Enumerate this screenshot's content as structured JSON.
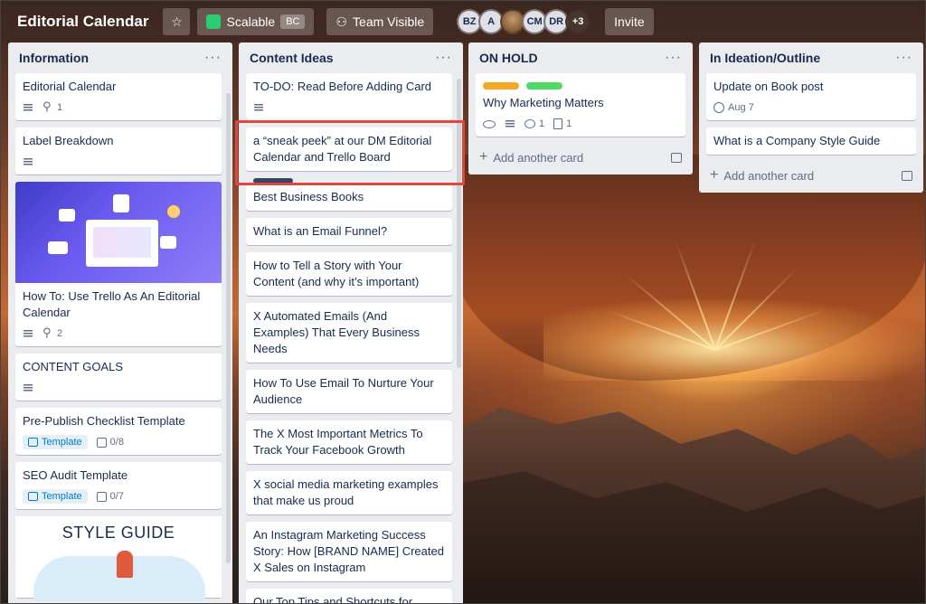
{
  "board": {
    "title": "Editorial Calendar",
    "workspace": "Scalable",
    "workspace_tag": "BC",
    "visibility": "Team Visible",
    "members": [
      "BZ",
      "A",
      "",
      "CM",
      "DR"
    ],
    "more_members": "+3",
    "invite_label": "Invite"
  },
  "lists": {
    "information": {
      "title": "Information",
      "cards": [
        {
          "title": "Editorial Calendar",
          "attachments": "1"
        },
        {
          "title": "Label Breakdown"
        },
        {
          "title": "How To: Use Trello As An Editorial Calendar",
          "attachments": "2"
        },
        {
          "title": "CONTENT GOALS"
        },
        {
          "title": "Pre-Publish Checklist Template",
          "template": "Template",
          "checklist": "0/8"
        },
        {
          "title": "SEO Audit Template",
          "template": "Template",
          "checklist": "0/7"
        }
      ],
      "style_guide_text": "STYLE GUIDE"
    },
    "content_ideas": {
      "title": "Content Ideas",
      "cards": [
        {
          "title": "TO-DO: Read Before Adding Card"
        },
        {
          "title": "a “sneak peek” at our DM Editorial Calendar and Trello Board"
        },
        {
          "title": "Best Business Books"
        },
        {
          "title": "What is an Email Funnel?"
        },
        {
          "title": "How to Tell a Story with Your Content (and why it’s important)"
        },
        {
          "title": "X Automated Emails (And Examples) That Every Business Needs"
        },
        {
          "title": "How To Use Email To Nurture Your Audience"
        },
        {
          "title": "The X Most Important Metrics To Track Your Facebook Growth"
        },
        {
          "title": "X social media marketing examples that make us proud"
        },
        {
          "title": "An Instagram Marketing Success Story: How [BRAND NAME] Created X Sales on Instagram"
        },
        {
          "title": "Our Top Tips and Shortcuts for"
        }
      ]
    },
    "on_hold": {
      "title": "ON HOLD",
      "label_colors": [
        "#f5a623",
        "#4cd964"
      ],
      "cards": [
        {
          "title": "Why Marketing Matters",
          "comments": "1",
          "attachments": "1"
        }
      ],
      "add_card": "Add another card"
    },
    "ideation": {
      "title": "In Ideation/Outline",
      "cards": [
        {
          "title": "Update on Book post",
          "due": "Aug 7"
        },
        {
          "title": "What is a Company Style Guide"
        }
      ],
      "add_card": "Add another card"
    }
  },
  "menu_glyph": "···",
  "plus_glyph": "+",
  "colors": {
    "highlight": "#e0483e",
    "accent_green": "#2ecc71"
  }
}
